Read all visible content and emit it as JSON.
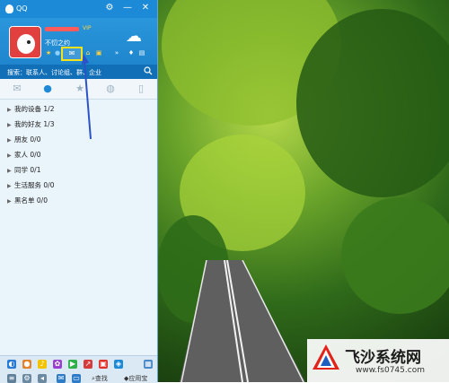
{
  "window": {
    "title": "QQ",
    "controls": [
      "settings-icon",
      "minimize-icon",
      "close-icon"
    ]
  },
  "profile": {
    "signature": "不忉之约",
    "weather_icon": "cloud-sun-icon",
    "vip_badge": "VIP"
  },
  "search": {
    "placeholder": "搜索：联系人、讨论组、群、企业"
  },
  "tabs": [
    "messages",
    "contacts",
    "favorites",
    "groups",
    "mobile"
  ],
  "groups": [
    {
      "name": "我的设备",
      "count": "1/2"
    },
    {
      "name": "我的好友",
      "count": "1/3"
    },
    {
      "name": "朋友",
      "count": "0/0"
    },
    {
      "name": "家人",
      "count": "0/0"
    },
    {
      "name": "同学",
      "count": "0/1"
    },
    {
      "name": "生活服务",
      "count": "0/0"
    },
    {
      "name": "黑名单",
      "count": "0/0"
    }
  ],
  "bottombar": {
    "find_label": "查找",
    "app_label": "应用宝"
  },
  "watermark": {
    "title": "飞沙系统网",
    "url": "www.fs0745.com"
  }
}
